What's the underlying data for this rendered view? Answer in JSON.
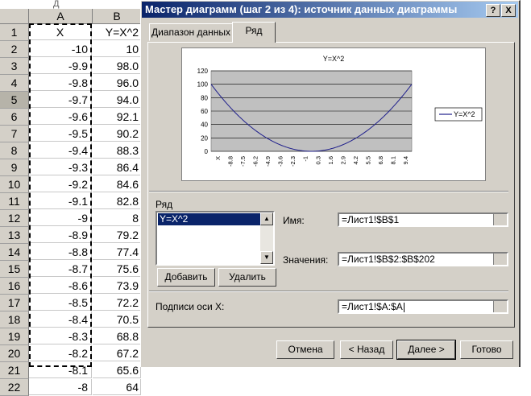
{
  "sheet": {
    "top_fragment": "Д",
    "columns": [
      "A",
      "B"
    ],
    "row_numbers": [
      "1",
      "2",
      "3",
      "4",
      "5",
      "6",
      "7",
      "8",
      "9",
      "10",
      "11",
      "12",
      "13",
      "14",
      "15",
      "16",
      "17",
      "18",
      "19",
      "20",
      "21",
      "22"
    ],
    "selected_row": "5",
    "col_a": [
      "X",
      "-10",
      "-9.9",
      "-9.8",
      "-9.7",
      "-9.6",
      "-9.5",
      "-9.4",
      "-9.3",
      "-9.2",
      "-9.1",
      "-9",
      "-8.9",
      "-8.8",
      "-8.7",
      "-8.6",
      "-8.5",
      "-8.4",
      "-8.3",
      "-8.2",
      "-8.1",
      "-8"
    ],
    "col_b": [
      "Y=X^2",
      "10",
      "98.0",
      "96.0",
      "94.0",
      "92.1",
      "90.2",
      "88.3",
      "86.4",
      "84.6",
      "82.8",
      "8",
      "79.2",
      "77.4",
      "75.6",
      "73.9",
      "72.2",
      "70.5",
      "68.8",
      "67.2",
      "65.6",
      "64"
    ]
  },
  "dialog": {
    "title": "Мастер диаграмм (шаг 2 из 4): источник данных диаграммы",
    "help_button": "?",
    "close_button": "X",
    "tabs": [
      "Диапазон данных",
      "Ряд"
    ],
    "active_tab": "Ряд",
    "series_section_label": "Ряд",
    "series_items": [
      "Y=X^2"
    ],
    "add_button": "Добавить",
    "delete_button": "Удалить",
    "name_label": "Имя:",
    "name_value": "=Лист1!$B$1",
    "values_label": "Значения:",
    "values_value": "=Лист1!$B$2:$B$202",
    "xlabels_label": "Подписи оси X:",
    "xlabels_value": "=Лист1!$A:$A",
    "buttons": {
      "cancel": "Отмена",
      "back": "< Назад",
      "next": "Далее >",
      "finish": "Готово"
    }
  },
  "chart_data": {
    "type": "line",
    "title": "Y=X^2",
    "ylim": [
      0,
      120
    ],
    "yticks": [
      "0",
      "20",
      "40",
      "60",
      "80",
      "100",
      "120"
    ],
    "x_ticks": [
      "X",
      "-8.8",
      "-7.5",
      "-6.2",
      "-4.9",
      "-3.6",
      "-2.3",
      "-1",
      "0.3",
      "1.6",
      "2.9",
      "4.2",
      "5.5",
      "6.8",
      "8.1",
      "9.4"
    ],
    "series": [
      {
        "name": "Y=X^2",
        "color": "#1f1f8c",
        "x": [
          -10,
          -9,
          -8,
          -7,
          -6,
          -5,
          -4,
          -3,
          -2,
          -1,
          0,
          1,
          2,
          3,
          4,
          5,
          6,
          7,
          8,
          9,
          10
        ],
        "values": [
          100,
          81,
          64,
          49,
          36,
          25,
          16,
          9,
          4,
          1,
          0,
          1,
          4,
          9,
          16,
          25,
          36,
          49,
          64,
          81,
          100
        ]
      }
    ],
    "legend_position": "right",
    "plot_area_color": "#c0c0c0",
    "grid": true
  }
}
